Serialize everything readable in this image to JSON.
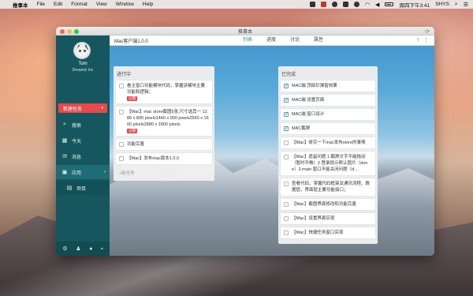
{
  "menubar": {
    "app_name": "推事本",
    "items": [
      "File",
      "Edit",
      "Format",
      "View",
      "Window",
      "Help"
    ],
    "clock": "周四下午3:41",
    "user": "SHYS"
  },
  "window": {
    "title": "推事本"
  },
  "sidebar": {
    "user_name": "Tom",
    "user_org": "Dreamix Inc",
    "new_task_label": "新建任务",
    "nav": [
      {
        "label": "搜索"
      },
      {
        "label": "今天"
      },
      {
        "label": "消息"
      },
      {
        "label": "应用"
      },
      {
        "label": "项目"
      }
    ]
  },
  "main": {
    "project_title": "Mac客户端1.0.0",
    "tabs": [
      "列表",
      "进度",
      "讨论",
      "属性"
    ],
    "columns": [
      {
        "title": "进行中",
        "cards": [
          {
            "text": "看主窗口功能模块代码，掌握该模块主要功能和逻辑；",
            "tag": "过期",
            "checked": false
          },
          {
            "text": "【Mac】mac store截图5张,尺寸选其一 1280 x 800 pixels1440 x 900 pixels2560 x 1600 pixels2880 x 1800 pixels",
            "tag": "过期",
            "checked": false
          },
          {
            "text": "功能完善",
            "tag": "",
            "checked": false
          },
          {
            "text": "【Mac】发布mac版本1.0.0",
            "tag": "",
            "checked": false
          }
        ],
        "add_label": "+新任务"
      },
      {
        "title": "已完成",
        "cards": [
          {
            "text": "MAC端 顶部拦弹窗效果",
            "checked": true
          },
          {
            "text": "MAC端 设置页面",
            "checked": true
          },
          {
            "text": "MAC端 窗口设计",
            "checked": true
          },
          {
            "text": "MAC截屏",
            "checked": true
          },
          {
            "text": "【Mac】研究一下mac发布store的事情",
            "checked": false
          },
          {
            "text": "【Mac】遗留问题 1.截屏文字不能拖动（暂时不做）2.登录提示默认图片（done）3.main 窗口不能关闭问题（d...",
            "checked": false
          },
          {
            "text": "查看代码，掌握代码框架及通讯流程，数据层，界面层主要功能接口；",
            "checked": false
          },
          {
            "text": "【Mac】截图界面修改和功能完善",
            "checked": false
          },
          {
            "text": "【Mac】设置界面实现",
            "checked": false
          },
          {
            "text": "【Mac】快捷任务窗口实现",
            "checked": false
          }
        ]
      }
    ]
  }
}
